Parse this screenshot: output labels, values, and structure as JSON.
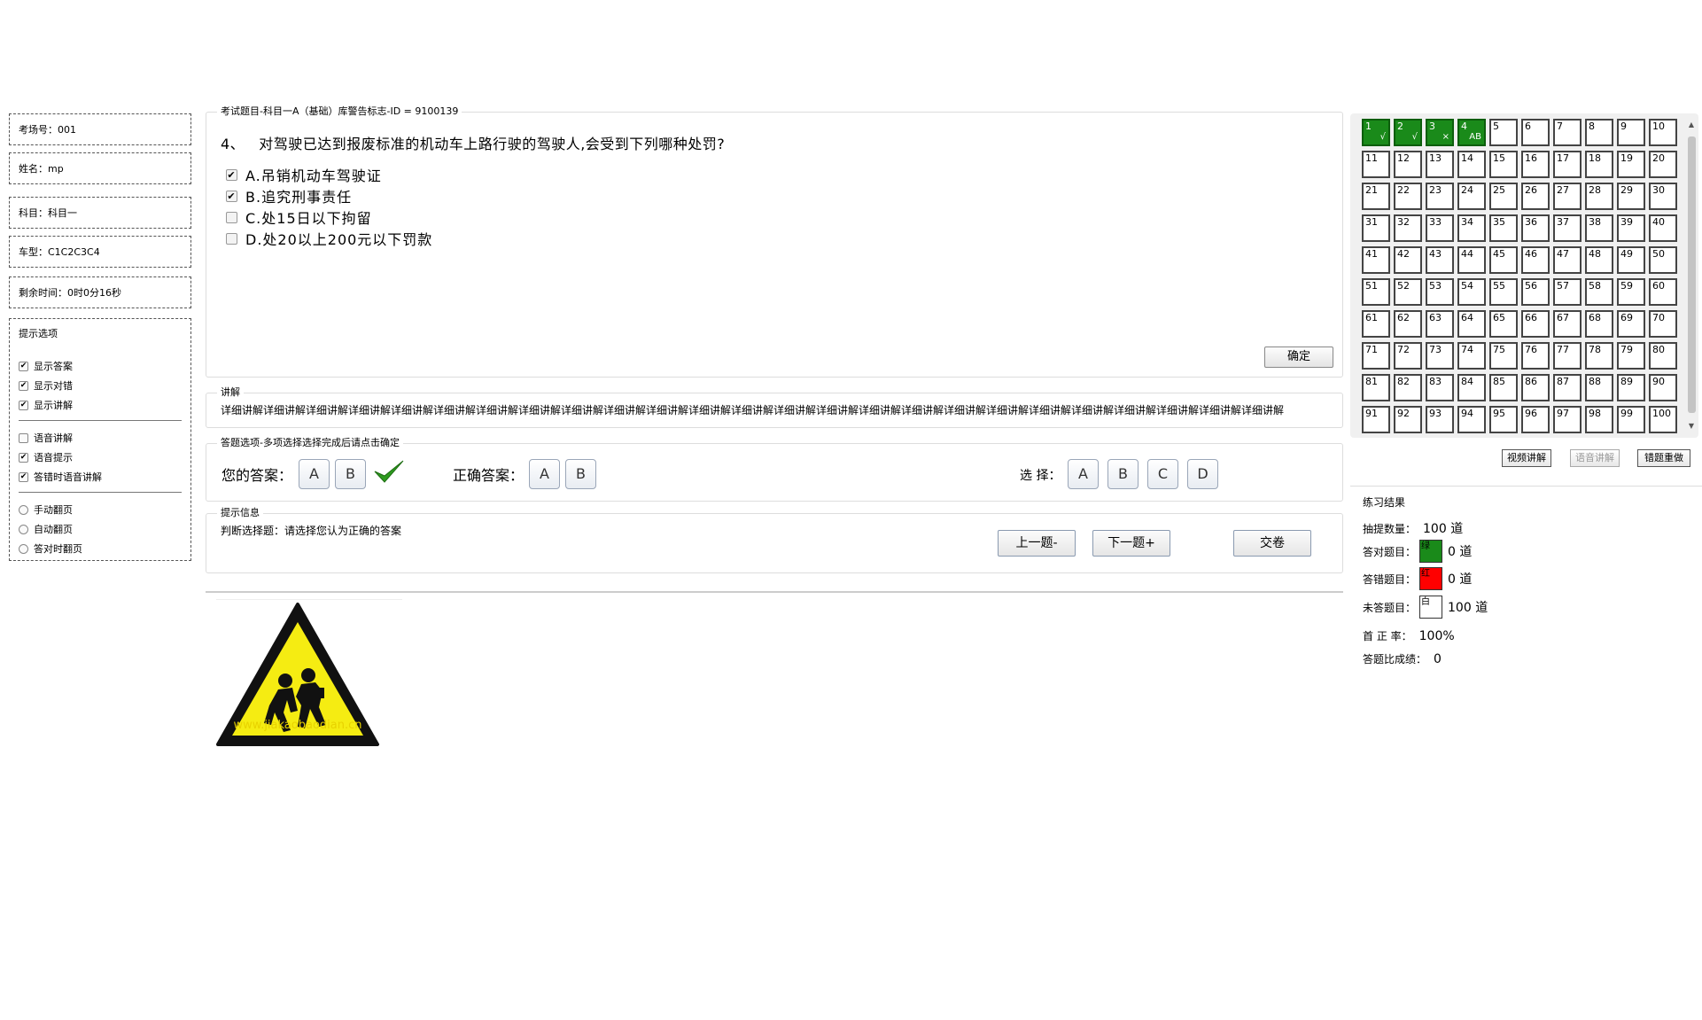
{
  "left_panel": {
    "exam_room": "考场号：001",
    "name": "姓名：mp",
    "subject": "科目：科目一",
    "car_type": "车型：C1C2C3C4",
    "time_left": "剩余时间：0时0分16秒",
    "options_title": "提示选项",
    "options": [
      {
        "label": "显示答案",
        "checked": true
      },
      {
        "label": "显示对错",
        "checked": true
      },
      {
        "label": "显示讲解",
        "checked": true
      },
      {
        "label": "语音讲解",
        "checked": false
      },
      {
        "label": "语音提示",
        "checked": true
      },
      {
        "label": "答错时语音讲解",
        "checked": true
      }
    ],
    "page_modes": [
      "手动翻页",
      "自动翻页",
      "答对时翻页"
    ]
  },
  "question_box": {
    "legend": "考试题目-科目一A（基础）库警告标志-ID = 9100139",
    "number": "4、",
    "text": "对驾驶已达到报废标准的机动车上路行驶的驾驶人,会受到下列哪种处罚?",
    "choices": [
      {
        "label": "A.吊销机动车驾驶证",
        "checked": true
      },
      {
        "label": "B.追究刑事责任",
        "checked": true
      },
      {
        "label": "C.处15日以下拘留",
        "checked": false
      },
      {
        "label": "D.处20以上200元以下罚款",
        "checked": false
      }
    ],
    "confirm_label": "确定"
  },
  "explanation": {
    "legend": "讲解",
    "text": "详细讲解详细讲解详细讲解详细讲解详细讲解详细讲解详细讲解详细讲解详细讲解详细讲解详细讲解详细讲解详细讲解详细讲解详细讲解详细讲解详细讲解详细讲解详细讲解详细讲解详细讲解详细讲解详细讲解详细讲解详细讲解"
  },
  "answer_box": {
    "legend": "答题选项-多项选择选择完成后请点击确定",
    "your_answer_label": "您的答案：",
    "your_answers": [
      "A",
      "B"
    ],
    "correct_label": "正确答案：",
    "correct_answers": [
      "A",
      "B"
    ],
    "select_label": "选 择：",
    "select_options": [
      "A",
      "B",
      "C",
      "D"
    ]
  },
  "hint_box": {
    "legend": "提示信息",
    "text": "判断选择题：请选择您认为正确的答案",
    "prev_label": "上一题-",
    "next_label": "下一题+",
    "submit_label": "交卷"
  },
  "grid": {
    "done_marks": [
      "√",
      "√",
      "×",
      "AB"
    ]
  },
  "side_buttons": {
    "video": "视频讲解",
    "voice": "语音讲解",
    "redo": "错题重做"
  },
  "results": {
    "title": "练习结果",
    "drawn_label": "抽提数量：",
    "drawn_value": "100 道",
    "correct_label": "答对题目：",
    "correct_swatch": "绿",
    "correct_value": "0 道",
    "wrong_label": "答错题目：",
    "wrong_swatch": "红",
    "wrong_value": "0 道",
    "unanswered_label": "未答题目：",
    "unanswered_swatch": "白",
    "unanswered_value": "100 道",
    "first_rate_label": "首 正 率：",
    "first_rate_value": "100%",
    "score_label": "答题比成绩：",
    "score_value": "0"
  },
  "colors": {
    "done_cell": "#1a8a1a",
    "wrong_swatch": "#ff0000",
    "correct_swatch": "#1a8a1a",
    "sign_yellow": "#f5ec12",
    "check_green": "#2e9b1f"
  },
  "sign_watermark": "www.jiakaobaodian.cn"
}
